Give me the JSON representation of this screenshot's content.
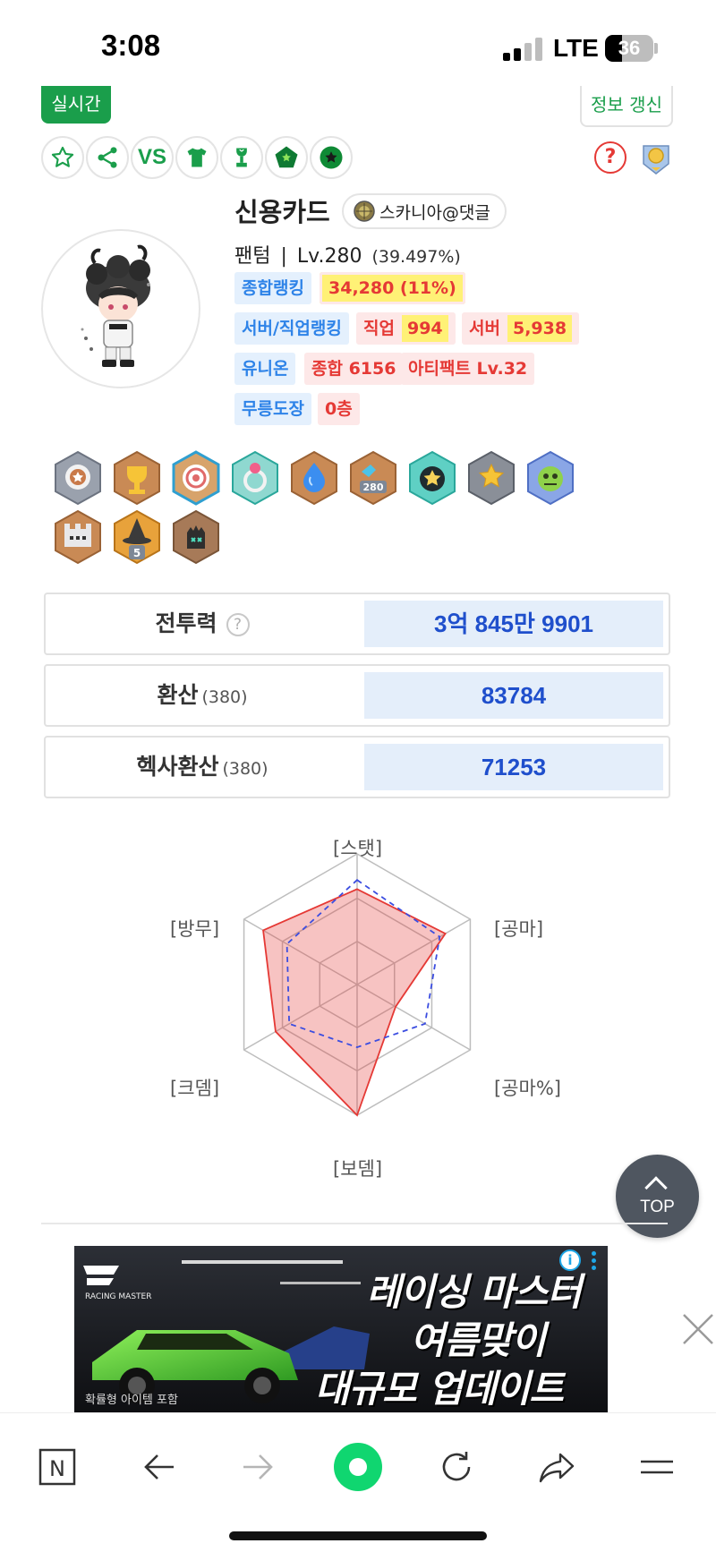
{
  "status_bar": {
    "time": "3:08",
    "network": "LTE",
    "battery": "36",
    "battery_level": 0.36
  },
  "top_buttons": {
    "realtime": "실시간",
    "refresh": "정보 갱신"
  },
  "action_icons": [
    "star-icon",
    "share-icon",
    "vs-compare",
    "shirt-icon",
    "trophy-icon",
    "pentagon-star-icon",
    "circle-star-icon"
  ],
  "vs_label": "VS",
  "help_symbol": "?",
  "character": {
    "name": "신용카드",
    "guild": "스카니아@댓글",
    "job": "팬텀",
    "separator": "|",
    "level": "Lv.280",
    "exp_pct": "(39.497%)"
  },
  "rankings": {
    "overall_label": "종합랭킹",
    "overall_value": "34,280  (11%)",
    "server_job_label": "서버/직업랭킹",
    "job_label": "직업",
    "job_value": "994",
    "server_label": "서버",
    "server_value": "5,938",
    "union_label": "유니온",
    "union_value": "종합 6156",
    "artifact_value": "아티팩트 Lv.32",
    "dojo_label": "무릉도장",
    "dojo_value": "0층"
  },
  "medals": [
    "medal-bronze",
    "medal-gold-trophy",
    "medal-target",
    "medal-ring",
    "medal-blue-drop",
    "medal-280",
    "medal-dark-star",
    "medal-gold-star",
    "medal-green-creature",
    "medal-castle",
    "medal-witch-hat",
    "medal-dark-glove"
  ],
  "medal_badge_280": "280",
  "medal_badge_5": "5",
  "stats": {
    "combat_label": "전투력",
    "combat_value": "3억 845만 9901",
    "conversion_label": "환산",
    "conversion_sub": "(380)",
    "conversion_value": "83784",
    "hexa_label": "헥사환산",
    "hexa_sub": "(380)",
    "hexa_value": "71253"
  },
  "radar": {
    "labels": [
      "[스탯]",
      "[공마]",
      "[공마%]",
      "[보뎀]",
      "[크뎀]",
      "[방무]"
    ],
    "character_values": [
      0.73,
      0.78,
      0.34,
      1.0,
      0.72,
      0.83
    ],
    "average_values": [
      0.8,
      0.73,
      0.6,
      0.48,
      0.6,
      0.62
    ],
    "colors": {
      "character": "#e53935",
      "average": "#3b4de0"
    }
  },
  "top_button": "TOP",
  "ad": {
    "brand": "RACING MASTER",
    "line1": "레이싱 마스터",
    "line2": "여름맞이",
    "line3": "대규모 업데이트",
    "note": "확률형 아이템 포함",
    "info_symbol": "i"
  },
  "bottom_nav": [
    "naver-n-icon",
    "back-arrow-icon",
    "forward-arrow-icon",
    "green-dot-home-icon",
    "reload-icon",
    "share-arrow-icon",
    "menu-icon"
  ],
  "bottom_nav_n": "N",
  "colors": {
    "accent_green": "#1a9e4b",
    "rank_blue": "#2e83e8",
    "rank_red": "#e53935",
    "value_blue": "#1f4fcc"
  }
}
